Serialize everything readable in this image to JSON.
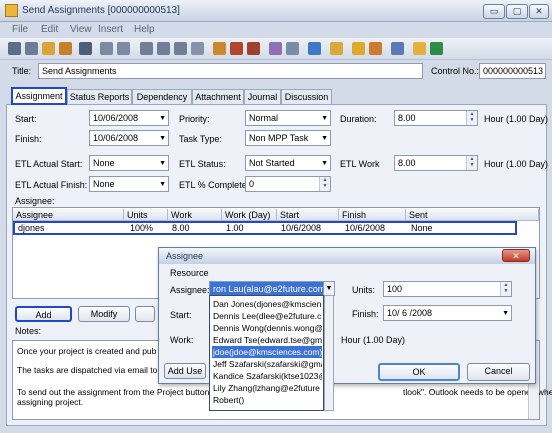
{
  "window": {
    "title": "Send Assignments [000000000513]",
    "minimize": "▭",
    "maximize": "▢",
    "close": "✕"
  },
  "menu": [
    "File",
    "Edit",
    "View",
    "Insert",
    "Help"
  ],
  "toolbar_icons": [
    "users-icon",
    "person-icon",
    "filter-icon",
    "person-add-icon",
    "undo-redo-icon",
    "indent-icon",
    "outdent-icon",
    "flag-icon",
    "stop-icon",
    "list-icon",
    "refresh-icon",
    "links-icon",
    "chart-icon",
    "tools-icon",
    "print-icon",
    "print-preview-icon",
    "grid-icon",
    "calendar-icon",
    "folder-icon",
    "settings-icon",
    "book-icon",
    "bookmark-icon",
    "excel-icon"
  ],
  "form": {
    "title_label": "Title:",
    "title_value": "Send Assignments",
    "control_label": "Control No.:",
    "control_value": "000000000513"
  },
  "tabs": [
    "Assignment",
    "Status Reports",
    "Dependency",
    "Attachment",
    "Journal",
    "Discussion"
  ],
  "assignment": {
    "start_label": "Start:",
    "start_value": "10/06/2008",
    "finish_label": "Finish:",
    "finish_value": "10/06/2008",
    "priority_label": "Priority:",
    "priority_value": "Normal",
    "task_type_label": "Task Type:",
    "task_type_value": "Non MPP Task",
    "duration_label": "Duration:",
    "duration_value": "8.00",
    "duration_unit": "Hour (1.00 Day)",
    "etl_actual_start_label": "ETL Actual Start:",
    "etl_actual_start_value": "None",
    "etl_actual_finish_label": "ETL Actual Finish:",
    "etl_actual_finish_value": "None",
    "etl_status_label": "ETL Status:",
    "etl_status_value": "Not Started",
    "etl_pct_label": "ETL % Complete:",
    "etl_pct_value": "0",
    "etl_work_label": "ETL Work",
    "etl_work_value": "8.00",
    "etl_work_unit": "Hour (1.00 Day)",
    "assignee_label": "Assignee:"
  },
  "grid": {
    "headers": [
      "Assignee",
      "Units",
      "Work",
      "Work (Day)",
      "Start",
      "Finish",
      "Sent"
    ],
    "row": [
      "djones",
      "100%",
      "8.00",
      "1.00",
      "10/6/2008",
      "10/6/2008",
      "None"
    ]
  },
  "buttons": {
    "add": "Add",
    "modify": "Modify"
  },
  "notes": {
    "label": "Notes:",
    "line1": "Once your project is created and pub",
    "line2": "The tasks are dispatched via email to",
    "line3": "To send out the assignment from the Project button",
    "line3b": "tlook\". Outlook needs to be opened when",
    "line4": "assigning project."
  },
  "dialog": {
    "title": "Assignee",
    "resource_label": "Resource",
    "assignee_label": "Assignee:",
    "assignee_value": "ron Lau(alau@e2future.com)",
    "start_label": "Start:",
    "work_label": "Work:",
    "units_label": "Units:",
    "units_value": "100",
    "finish_label": "Finish:",
    "finish_value": "10/ 6 /2008",
    "hour_text": "Hour (1.00 Day)",
    "add_user_label": "Add Use",
    "ok": "OK",
    "cancel": "Cancel",
    "close": "✕",
    "dropdown_items": [
      "Dan Jones(djones@kmscien",
      "Dennis Lee(dlee@e2future.c",
      "Dennis Wong(dennis.wong@",
      "Edward Tse(edward.tse@gm",
      "jdoe(jdoe@kmsciences.com)",
      "Jeff Szafarski(szafarski@gma",
      "Kandice Szafarski(ktse1023@",
      "Lily Zhang(lzhang@e2future",
      "Robert()"
    ],
    "selected_index": 4
  }
}
